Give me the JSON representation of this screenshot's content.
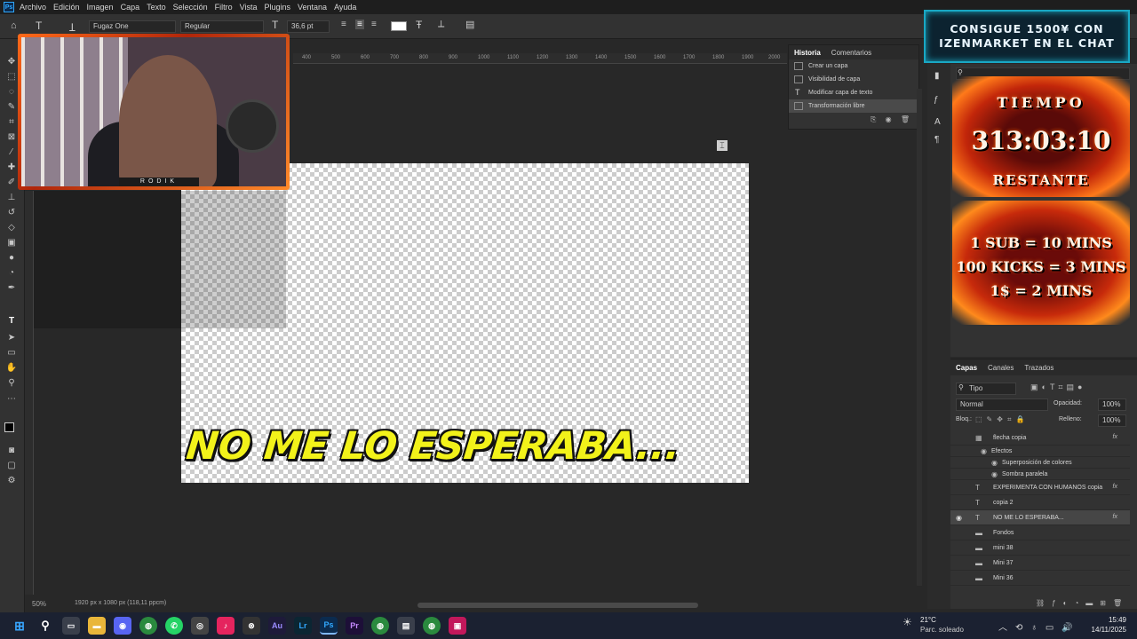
{
  "menu": {
    "items": [
      "Archivo",
      "Edición",
      "Imagen",
      "Capa",
      "Texto",
      "Selección",
      "Filtro",
      "Vista",
      "Plugins",
      "Ventana",
      "Ayuda"
    ]
  },
  "options": {
    "font_family": "Fugaz One",
    "font_style": "Regular",
    "font_size": "36,6 pt"
  },
  "canvas": {
    "caption": "NO ME LO ESPERABA..."
  },
  "webcam": {
    "tag": "RODIK"
  },
  "history": {
    "tabs": [
      "Historia",
      "Comentarios"
    ],
    "items": [
      "Crear un capa",
      "Visibilidad de capa",
      "Modificar capa de texto",
      "Transformación libre"
    ]
  },
  "promo": {
    "line1": "CONSIGUE 1500¥ CON",
    "line2": "IZENMARKET EN EL CHAT"
  },
  "overlay": {
    "timer_title": "TIEMPO",
    "timer_value": "313:03:10",
    "timer_sub": "RESTANTE",
    "rule1": "1 SUB = 10 MINS",
    "rule2": "100 KICKS = 3 MINS",
    "rule3": "1$ = 2 MINS"
  },
  "layers": {
    "tabs": [
      "Capas",
      "Canales",
      "Trazados"
    ],
    "filter": "Tipo",
    "blend": "Normal",
    "opacity_label": "Opacidad:",
    "opacity": "100%",
    "lock_label": "Bloq.:",
    "fill_label": "Relleno:",
    "fill": "100%",
    "rows": [
      {
        "name": "flecha copia",
        "icon": "▦",
        "fx": "fx"
      },
      {
        "name": "Efectos",
        "icon": "",
        "fx": ""
      },
      {
        "name": "Superposición de colores",
        "icon": "",
        "fx": ""
      },
      {
        "name": "Sombra paralela",
        "icon": "",
        "fx": ""
      },
      {
        "name": "EXPERIMENTA CON HUMANOS copia",
        "icon": "T",
        "fx": "fx"
      },
      {
        "name": "copia 2",
        "icon": "T",
        "fx": ""
      },
      {
        "name": "NO ME LO ESPERABA...",
        "icon": "T",
        "fx": "fx"
      },
      {
        "name": "Fondos",
        "icon": "▬",
        "fx": ""
      },
      {
        "name": "mini 38",
        "icon": "▬",
        "fx": ""
      },
      {
        "name": "Mini 37",
        "icon": "▬",
        "fx": ""
      },
      {
        "name": "Mini 36",
        "icon": "▬",
        "fx": ""
      }
    ]
  },
  "status": {
    "zoom": "50%",
    "doc": "1920 px x 1080 px (118,11 ppcm)"
  },
  "ruler": {
    "labels": [
      "400",
      "500",
      "600",
      "700",
      "800",
      "900",
      "1000",
      "1100",
      "1200",
      "1300",
      "1400",
      "1500",
      "1600",
      "1700",
      "1800",
      "1900",
      "2000"
    ]
  },
  "taskbar": {
    "weather_temp": "21°C",
    "weather_desc": "Parc. soleado",
    "time": "15:49",
    "date": "14/11/2025",
    "apps": [
      "Au",
      "Lr",
      "Ps",
      "Pr"
    ]
  }
}
